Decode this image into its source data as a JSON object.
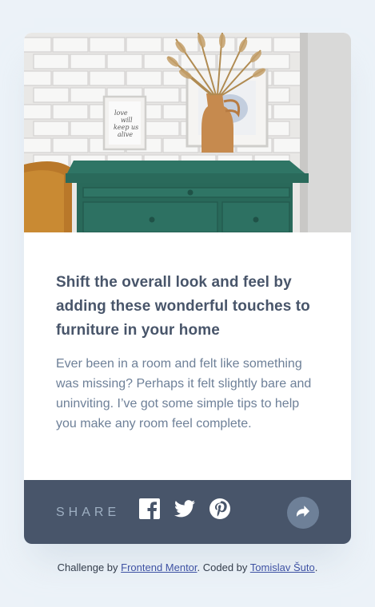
{
  "article": {
    "title": "Shift the overall look and feel by adding these wonderful touches to furniture in your home",
    "description": "Ever been in a room and felt like something was missing? Perhaps it felt slightly bare and uninviting. I’ve got some simple tips to help you make any room feel complete.",
    "image_art_text": "love will keep us alive"
  },
  "share": {
    "label": "SHARE",
    "icons": [
      "facebook-icon",
      "twitter-icon",
      "pinterest-icon",
      "share-icon"
    ]
  },
  "attribution": {
    "prefix": "Challenge by ",
    "link1": "Frontend Mentor",
    "middle": ". Coded by ",
    "link2": "Tomislav Šuto",
    "suffix": "."
  },
  "colors": {
    "background": "#ecf2f8",
    "bar": "#48556a",
    "title": "#48556a",
    "text": "#6e8098",
    "share_button": "#6e8098",
    "label": "#9eafc2"
  }
}
